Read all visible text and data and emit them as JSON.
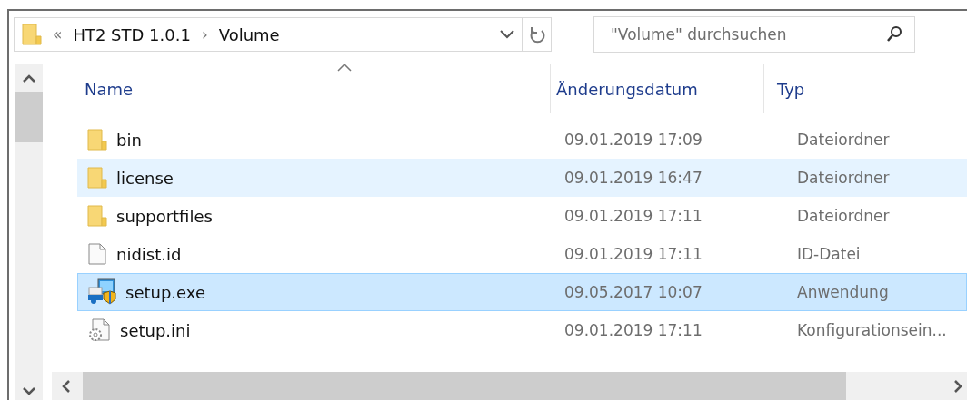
{
  "address_bar": {
    "overflow": "«",
    "path": [
      {
        "label": "HT2 STD 1.0.1"
      },
      {
        "label": "Volume"
      }
    ],
    "separator": "›"
  },
  "search": {
    "placeholder": "\"Volume\" durchsuchen"
  },
  "columns": [
    {
      "label": "Name",
      "sorted": true
    },
    {
      "label": "Änderungsdatum",
      "sorted": false
    },
    {
      "label": "Typ",
      "sorted": false
    }
  ],
  "rows": [
    {
      "name": "bin",
      "kind": "folder",
      "date": "09.01.2019 17:09",
      "type": "Dateiordner",
      "selected": false,
      "hovered": false
    },
    {
      "name": "license",
      "kind": "folder",
      "date": "09.01.2019 16:47",
      "type": "Dateiordner",
      "selected": false,
      "hovered": true
    },
    {
      "name": "supportfiles",
      "kind": "folder",
      "date": "09.01.2019 17:11",
      "type": "Dateiordner",
      "selected": false,
      "hovered": false
    },
    {
      "name": "nidist.id",
      "kind": "file",
      "date": "09.01.2019 17:11",
      "type": "ID-Datei",
      "selected": false,
      "hovered": false
    },
    {
      "name": "setup.exe",
      "kind": "app",
      "date": "09.05.2017 10:07",
      "type": "Anwendung",
      "selected": true,
      "hovered": false
    },
    {
      "name": "setup.ini",
      "kind": "config",
      "date": "09.01.2019 17:11",
      "type": "Konfigurationsein...",
      "selected": false,
      "hovered": false
    }
  ]
}
